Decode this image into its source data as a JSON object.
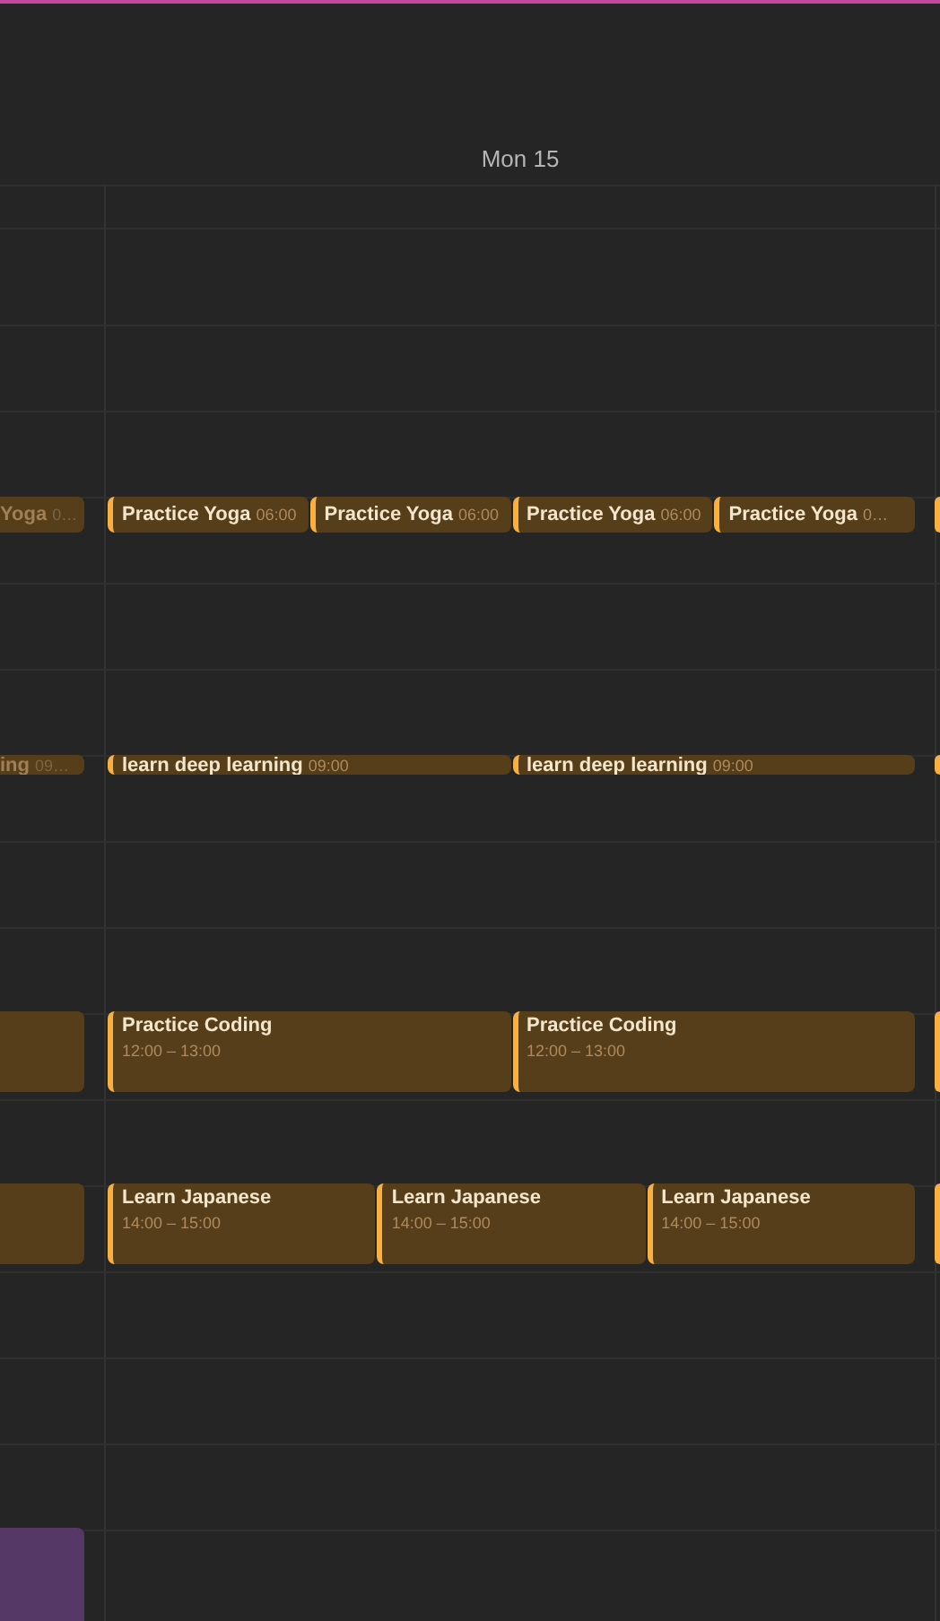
{
  "header": {
    "day_label": "Mon 15"
  },
  "rows": [
    {
      "kind": "compact",
      "cells": [
        {
          "events": [
            {
              "kind": "event",
              "title": "Yoga",
              "time": "0…",
              "past": true,
              "color": "#563e1b"
            }
          ]
        },
        {
          "events": [
            {
              "kind": "event",
              "title": "Practice Yoga",
              "time": "06:00",
              "past": false,
              "color": "#563e1b"
            },
            {
              "kind": "event",
              "title": "Practice Yoga",
              "time": "06:00",
              "past": false,
              "color": "#563e1b"
            },
            {
              "kind": "event",
              "title": "Practice Yoga",
              "time": "06:00",
              "past": false,
              "color": "#563e1b"
            },
            {
              "kind": "event",
              "title": "Practice Yoga",
              "time": "0…",
              "past": false,
              "color": "#563e1b"
            }
          ]
        },
        {
          "events": [
            {
              "kind": "stripe"
            }
          ]
        }
      ]
    },
    {
      "kind": "ribbon",
      "cells": [
        {
          "events": [
            {
              "kind": "event",
              "title": "ing",
              "time": "09…",
              "past": true,
              "color": "#563e1b"
            }
          ]
        },
        {
          "events": [
            {
              "kind": "event",
              "title": "learn deep learning",
              "time": "09:00",
              "past": false,
              "color": "#563e1b"
            },
            {
              "kind": "event",
              "title": "learn deep learning",
              "time": "09:00",
              "past": false,
              "color": "#563e1b"
            }
          ]
        },
        {
          "events": [
            {
              "kind": "stripe"
            }
          ]
        }
      ]
    },
    {
      "kind": "block",
      "cells": [
        {
          "events": [
            {
              "kind": "event",
              "color": "#563e1b"
            }
          ]
        },
        {
          "events": [
            {
              "kind": "event",
              "title": "Practice Coding",
              "time": "12:00 – 13:00",
              "past": false,
              "color": "#563e1b"
            },
            {
              "kind": "event",
              "title": "Practice Coding",
              "time": "12:00 – 13:00",
              "past": false,
              "color": "#563e1b"
            }
          ]
        },
        {
          "events": [
            {
              "kind": "stripe"
            }
          ]
        }
      ]
    },
    {
      "kind": "block",
      "cells": [
        {
          "events": [
            {
              "kind": "event",
              "color": "#563e1b"
            }
          ]
        },
        {
          "events": [
            {
              "kind": "event",
              "title": "Learn Japanese",
              "time": "14:00 – 15:00",
              "past": false,
              "color": "#563e1b"
            },
            {
              "kind": "event",
              "title": "Learn Japanese",
              "time": "14:00 – 15:00",
              "past": false,
              "color": "#563e1b"
            },
            {
              "kind": "event",
              "title": "Learn Japanese",
              "time": "14:00 – 15:00",
              "past": false,
              "color": "#563e1b"
            }
          ]
        },
        {
          "events": [
            {
              "kind": "stripe"
            }
          ]
        }
      ]
    },
    {
      "kind": "tall",
      "cells": [
        {
          "events": [
            {
              "kind": "event",
              "color": "#553865"
            }
          ]
        }
      ]
    }
  ]
}
